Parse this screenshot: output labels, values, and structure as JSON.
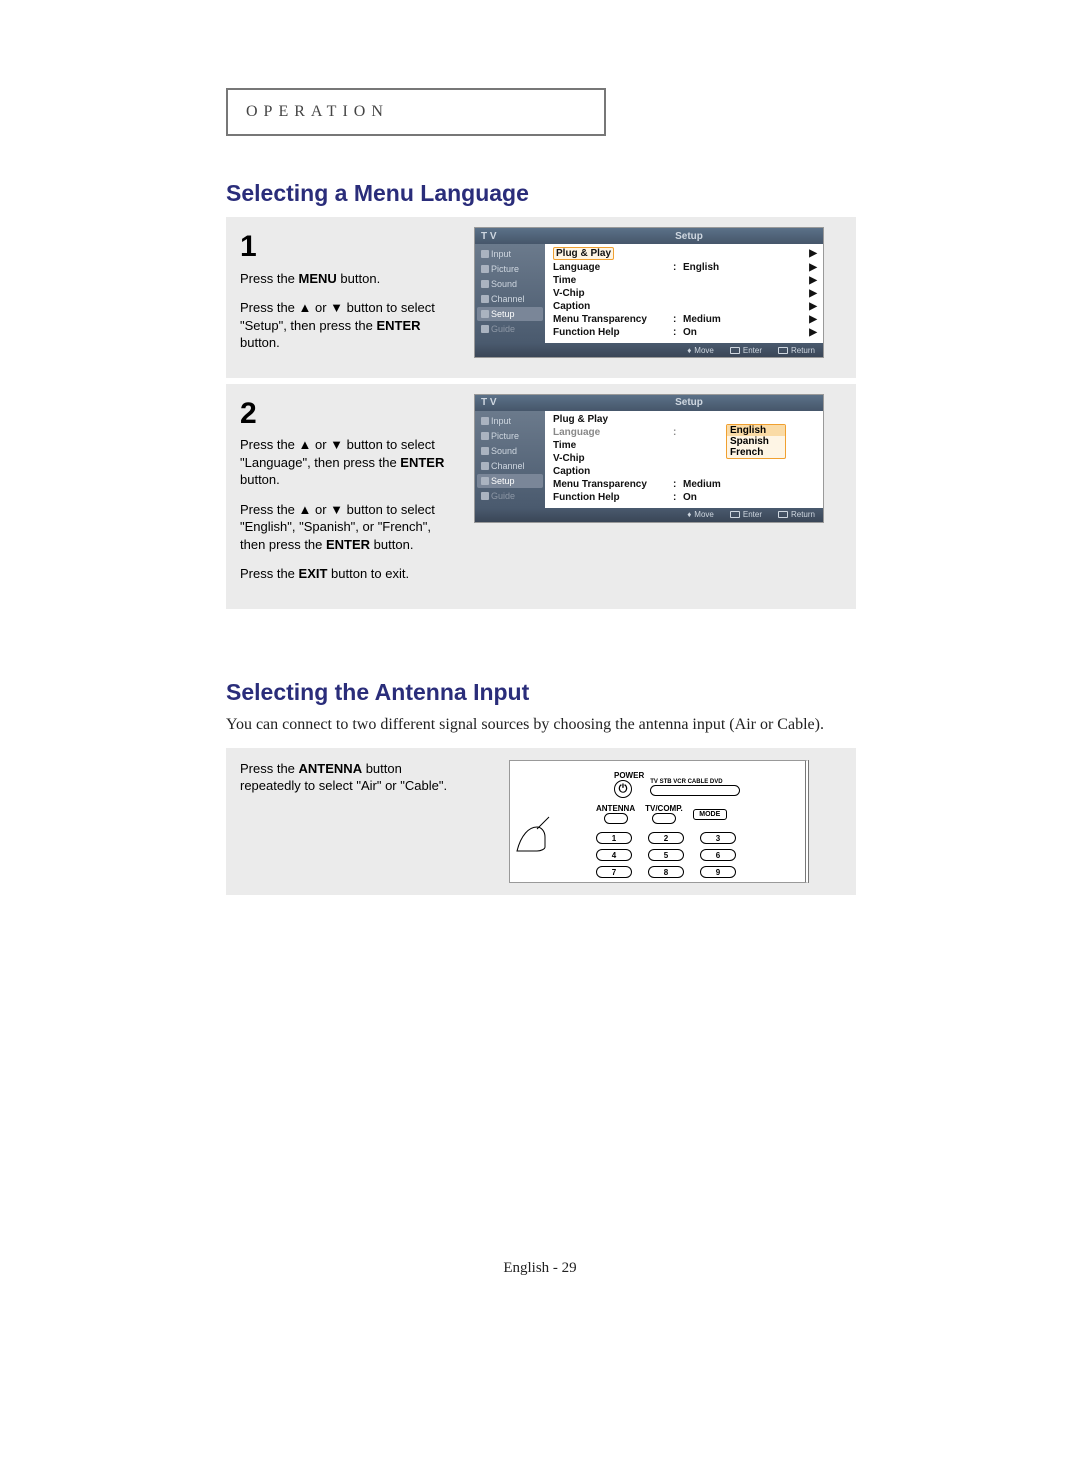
{
  "header": "OPERATION",
  "section1": {
    "title": "Selecting a Menu Language",
    "step1": {
      "num": "1",
      "p1a": "Press the ",
      "p1b": "MENU",
      "p1c": " button.",
      "p2a": "Press the ▲ or ▼ button to select \"Setup\", then press the ",
      "p2b": "ENTER",
      "p2c": " button."
    },
    "step2": {
      "num": "2",
      "p1a": "Press the ▲ or ▼ button to select \"Language\", then press the ",
      "p1b": "ENTER",
      "p1c": " button.",
      "p2a": "Press the ▲ or ▼ button to select \"English\", \"Spanish\", or \"French\", then press the ",
      "p2b": "ENTER",
      "p2c": " button.",
      "p3a": "Press the ",
      "p3b": "EXIT",
      "p3c": " button to exit."
    }
  },
  "osd": {
    "tv": "T V",
    "setup": "Setup",
    "tabs": [
      "Input",
      "Picture",
      "Sound",
      "Channel",
      "Setup",
      "Guide"
    ],
    "rows": {
      "plug": "Plug & Play",
      "language": "Language",
      "time": "Time",
      "vchip": "V-Chip",
      "caption": "Caption",
      "mt": "Menu Transparency ",
      "mt_sep": ": ",
      "mt_val": "Medium",
      "fh": "Function Help",
      "fh_sep": ": ",
      "fh_val": "On",
      "lang_sep": ": ",
      "lang_val": "English"
    },
    "lang_options": [
      "English",
      "Spanish",
      "French"
    ],
    "footer": {
      "move": "Move",
      "enter": "Enter",
      "return": "Return"
    }
  },
  "section2": {
    "title": "Selecting the Antenna Input",
    "intro": "You can connect to two different signal sources by choosing the antenna input (Air or Cable).",
    "p1a": "Press the ",
    "p1b": "ANTENNA",
    "p1c": " button repeatedly to select \"Air\" or \"Cable\"."
  },
  "remote": {
    "power": "POWER",
    "srcrow": "TV  STB  VCR  CABLE  DVD",
    "antenna": "ANTENNA",
    "tvcomp": "TV/COMP.",
    "mode": "MODE",
    "keys": [
      "1",
      "2",
      "3",
      "4",
      "5",
      "6",
      "7",
      "8",
      "9"
    ]
  },
  "footer": "English - 29"
}
